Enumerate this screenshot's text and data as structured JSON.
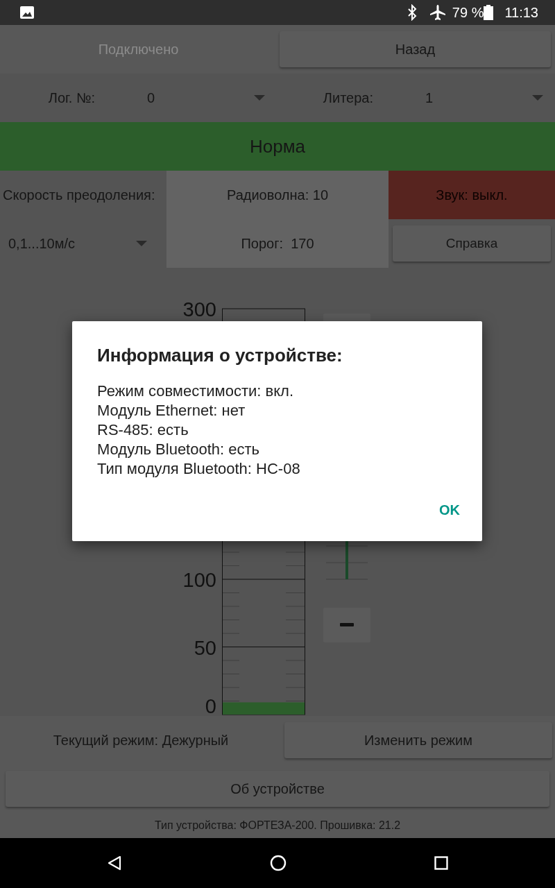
{
  "status_bar": {
    "battery": "79 %",
    "time": "11:13"
  },
  "connection_button": {
    "label": "Подключено",
    "disabled": true
  },
  "back_button": {
    "label": "Назад"
  },
  "log_number": {
    "label": "Лог. №:",
    "value": "0"
  },
  "litera": {
    "label": "Литера:",
    "value": "1"
  },
  "state_banner": {
    "text": "Норма"
  },
  "speed": {
    "label": "Скорость преодоления:",
    "value": "0,1...10м/с"
  },
  "radio": {
    "wave": "Радиоволна: 10",
    "threshold": "Порог:  170"
  },
  "sound": {
    "text": "Звук: выкл.",
    "on": false
  },
  "help_button": {
    "label": "Справка"
  },
  "gauge": {
    "scale_labels": [
      "300",
      "100",
      "50",
      "0"
    ],
    "level": 0.03
  },
  "mode": {
    "text": "Текущий режим: Дежурный",
    "button": "Изменить режим"
  },
  "about_button": {
    "label": "Об устройстве"
  },
  "footer": {
    "text": "Тип устройства: ФОРТЕЗА-200. Прошивка: 21.2"
  },
  "dialog": {
    "title": "Информация о устройстве:",
    "lines": [
      "Режим совместимости: вкл.",
      "Модуль Ethernet: нет",
      "RS-485: есть",
      "Модуль Bluetooth: есть",
      "Тип модуля Bluetooth: HC-08"
    ],
    "ok": "OK"
  }
}
